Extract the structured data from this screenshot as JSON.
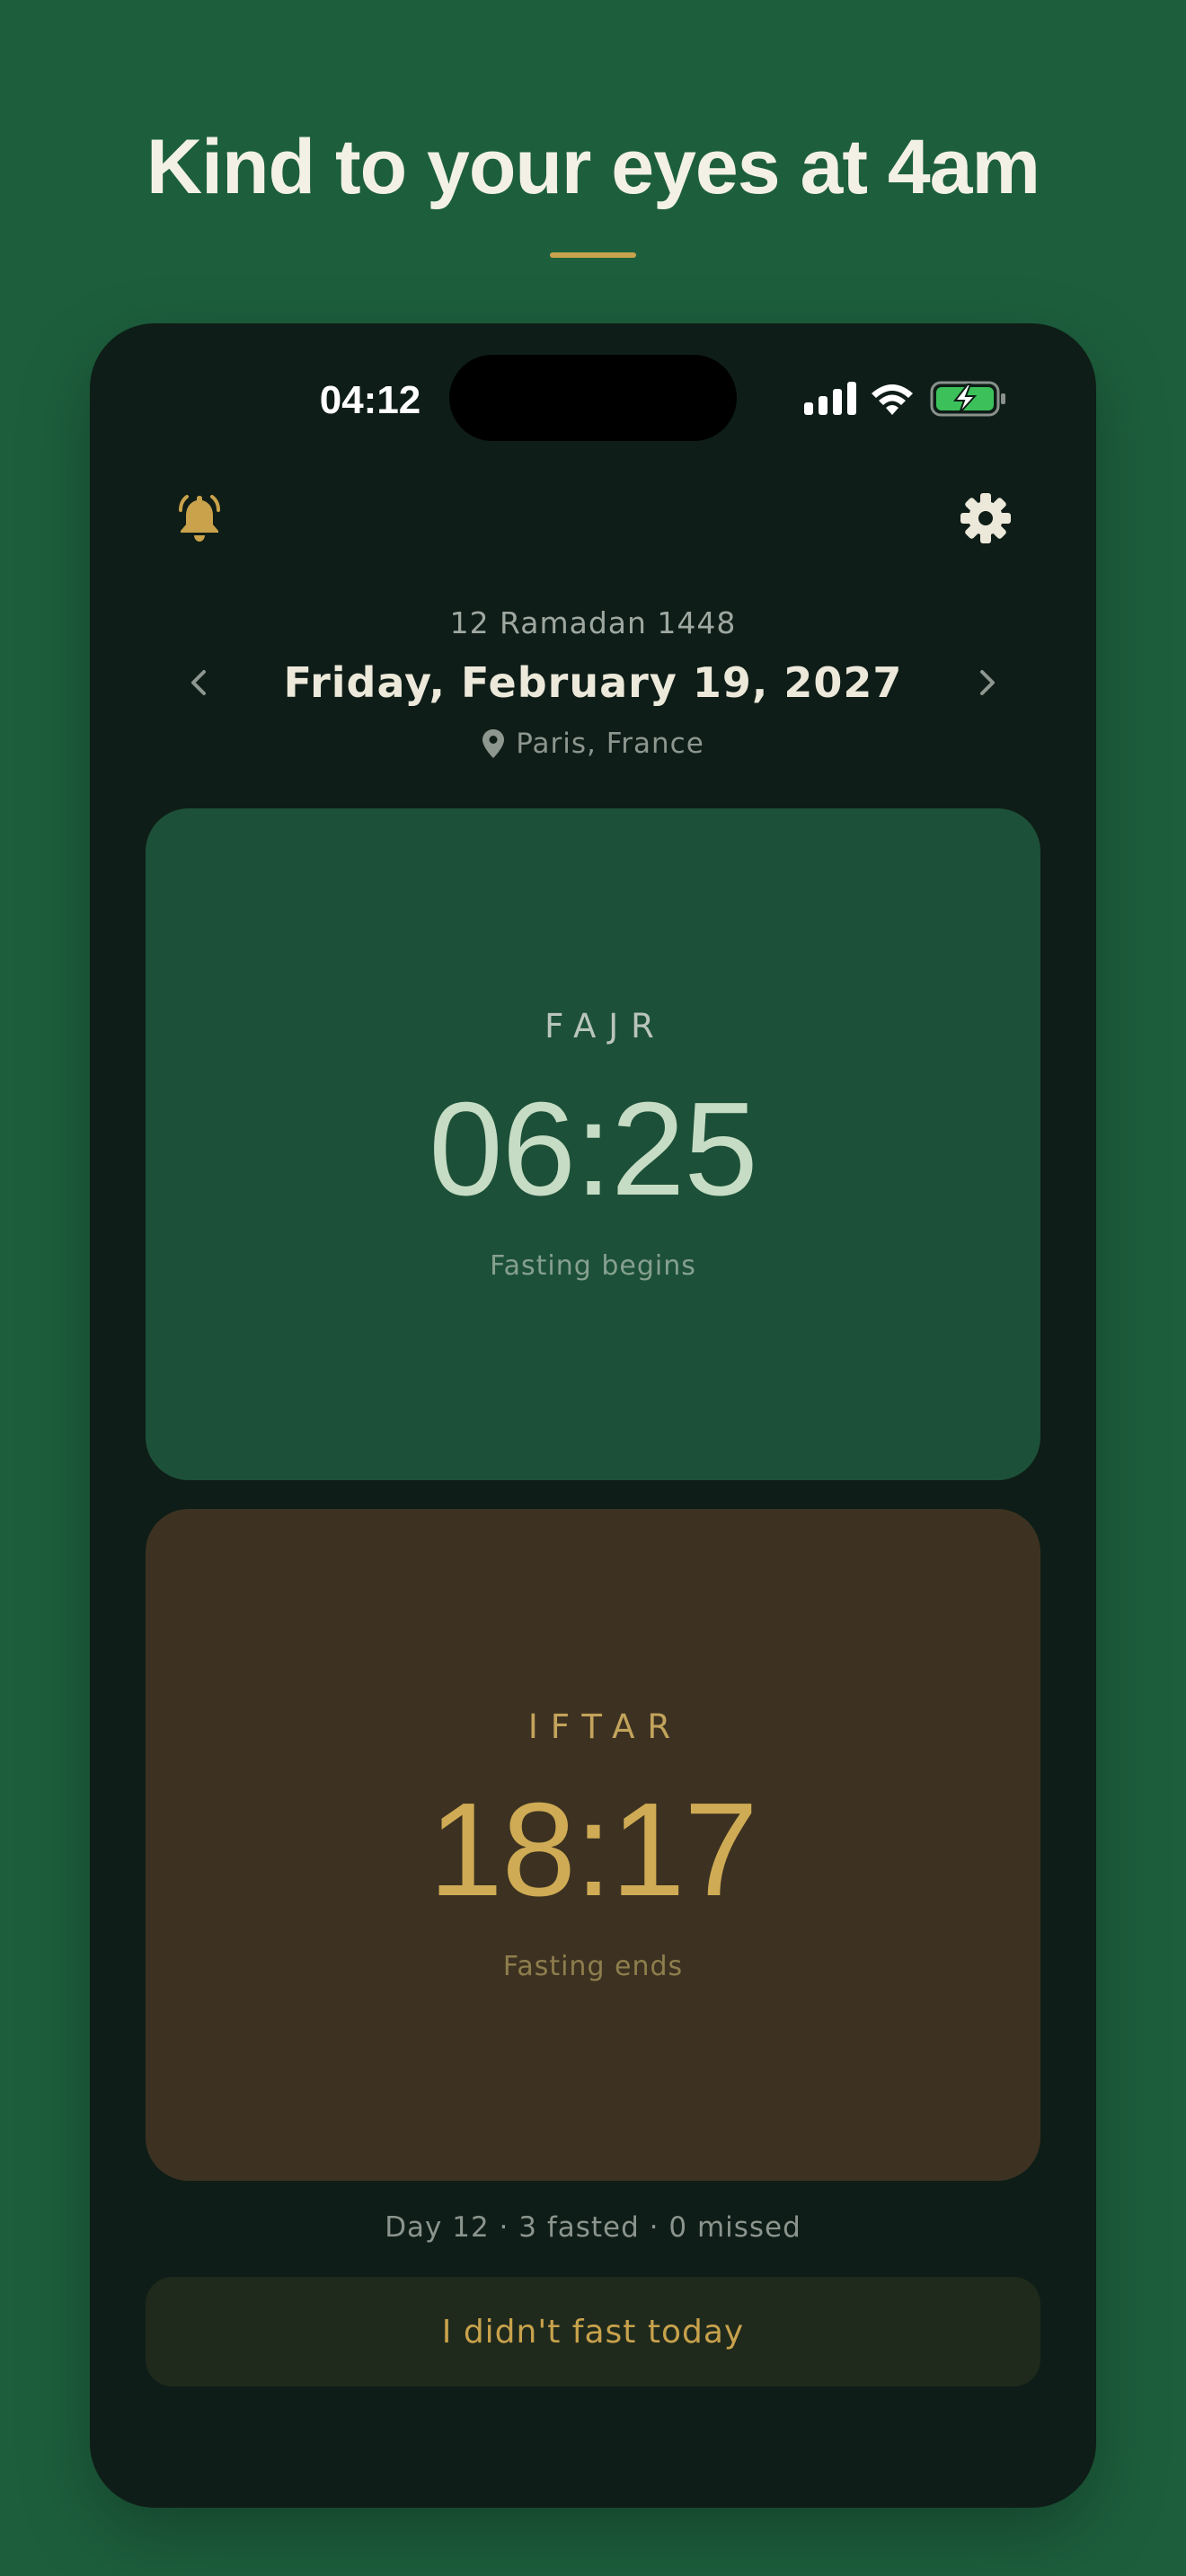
{
  "headline": "Kind to your eyes at 4am",
  "colors": {
    "background": "#1d5f3d",
    "phone": "#0e1d17",
    "accent_gold": "#c8a24c",
    "fajr_card": "#1d5038",
    "iftar_card": "#3d3221",
    "battery": "#3cc15a"
  },
  "status_bar": {
    "time": "04:12",
    "icons": [
      "cellular-signal-icon",
      "wifi-icon",
      "battery-charging-icon"
    ]
  },
  "header": {
    "left_icon": "bell-icon",
    "right_icon": "gear-icon"
  },
  "date_nav": {
    "hijri": "12 Ramadan 1448",
    "gregorian": "Friday, February 19, 2027",
    "location": "Paris, France",
    "prev_icon": "chevron-left-icon",
    "next_icon": "chevron-right-icon"
  },
  "fajr": {
    "label": "FAJR",
    "time": "06:25",
    "subtitle": "Fasting begins"
  },
  "iftar": {
    "label": "IFTAR",
    "time": "18:17",
    "subtitle": "Fasting ends"
  },
  "stats": "Day 12 · 3 fasted · 0 missed",
  "action_button": "I didn't fast today"
}
